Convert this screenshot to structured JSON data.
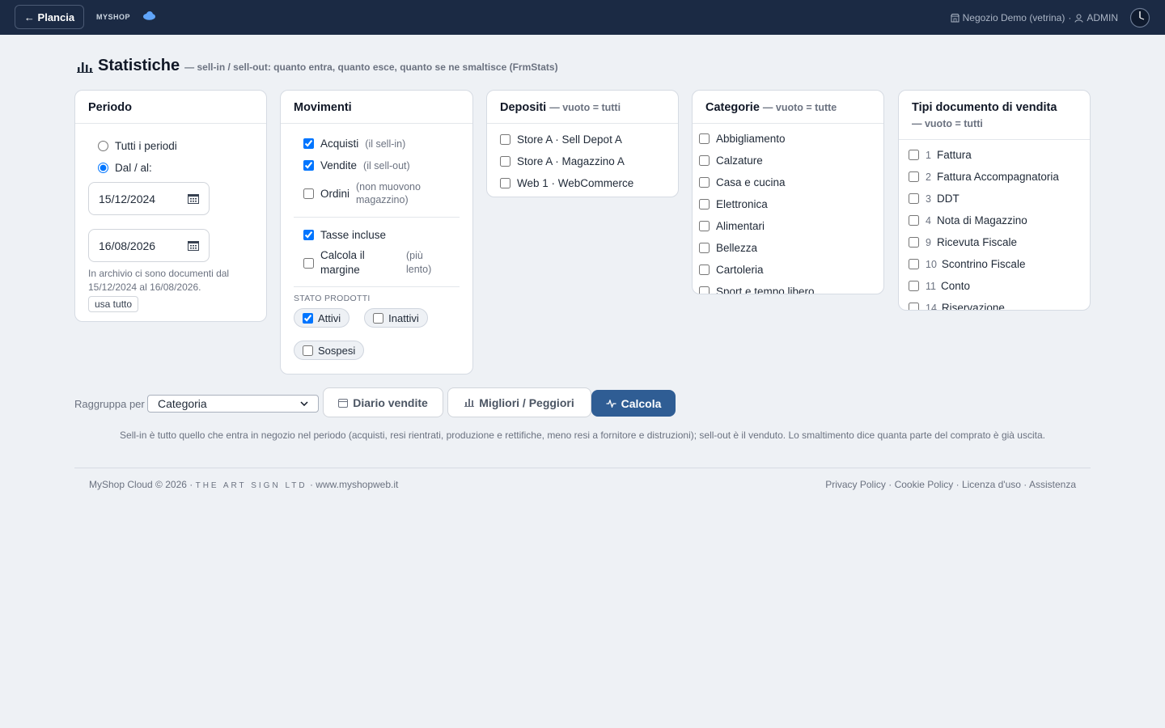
{
  "topbar": {
    "back_label": "← Plancia",
    "brand": "MYSHOP",
    "shop": "Negozio Demo (vetrina)",
    "separator": "·",
    "user": "ADMIN"
  },
  "header": {
    "title": "Statistiche",
    "subtitle": "— sell-in / sell-out: quanto entra, quanto esce, quanto se ne smaltisce (FrmStats)"
  },
  "periodo": {
    "title": "Periodo",
    "option_all": "Tutti i periodi",
    "option_range": "Dal / al:",
    "date_from": "15/12/2024",
    "date_to": "16/08/2026",
    "archive_note": "In archivio ci sono documenti dal 15/12/2024 al 16/08/2026.",
    "use_all": "usa tutto"
  },
  "movimenti": {
    "title": "Movimenti",
    "acquisti": "Acquisti",
    "acquisti_note": "(il sell-in)",
    "vendite": "Vendite",
    "vendite_note": "(il sell-out)",
    "ordini": "Ordini",
    "ordini_note": "(non muovono magazzino)",
    "tasse": "Tasse incluse",
    "margine": "Calcola il margine",
    "margine_note": "(più lento)",
    "stato_label": "STATO PRODOTTI",
    "attivi": "Attivi",
    "inattivi": "Inattivi",
    "sospesi": "Sospesi"
  },
  "depositi": {
    "title": "Depositi",
    "hint": "— vuoto = tutti",
    "items": [
      "Store A · Sell Depot A",
      "Store A · Magazzino A",
      "Web 1 · WebCommerce"
    ]
  },
  "categorie": {
    "title": "Categorie",
    "hint": "— vuoto = tutte",
    "items": [
      "Abbigliamento",
      "Calzature",
      "Casa e cucina",
      "Elettronica",
      "Alimentari",
      "Bellezza",
      "Cartoleria",
      "Sport e tempo libero"
    ]
  },
  "tipi": {
    "title": "Tipi documento di vendita",
    "hint": "— vuoto = tutti",
    "items": [
      {
        "num": "1",
        "label": "Fattura"
      },
      {
        "num": "2",
        "label": "Fattura Accompagnatoria"
      },
      {
        "num": "3",
        "label": "DDT"
      },
      {
        "num": "4",
        "label": "Nota di Magazzino"
      },
      {
        "num": "9",
        "label": "Ricevuta Fiscale"
      },
      {
        "num": "10",
        "label": "Scontrino Fiscale"
      },
      {
        "num": "11",
        "label": "Conto"
      },
      {
        "num": "14",
        "label": "Riservazione"
      }
    ]
  },
  "controls": {
    "group_label": "Raggruppa per",
    "group_value": "Categoria",
    "diario": "Diario vendite",
    "migliori": "Migliori / Peggiori",
    "calcola": "Calcola"
  },
  "explain": "Sell-in è tutto quello che entra in negozio nel periodo (acquisti, resi rientrati, produzione e rettifiche, meno resi a fornitore e distruzioni); sell-out è il venduto. Lo smaltimento dice quanta parte del comprato è già uscita.",
  "footer": {
    "copyright": "MyShop Cloud © 2026 ·",
    "company": "THE ART SIGN LTD",
    "site": "· www.myshopweb.it",
    "links": [
      "Privacy Policy",
      "Cookie Policy",
      "Licenza d'uso",
      "Assistenza"
    ]
  }
}
